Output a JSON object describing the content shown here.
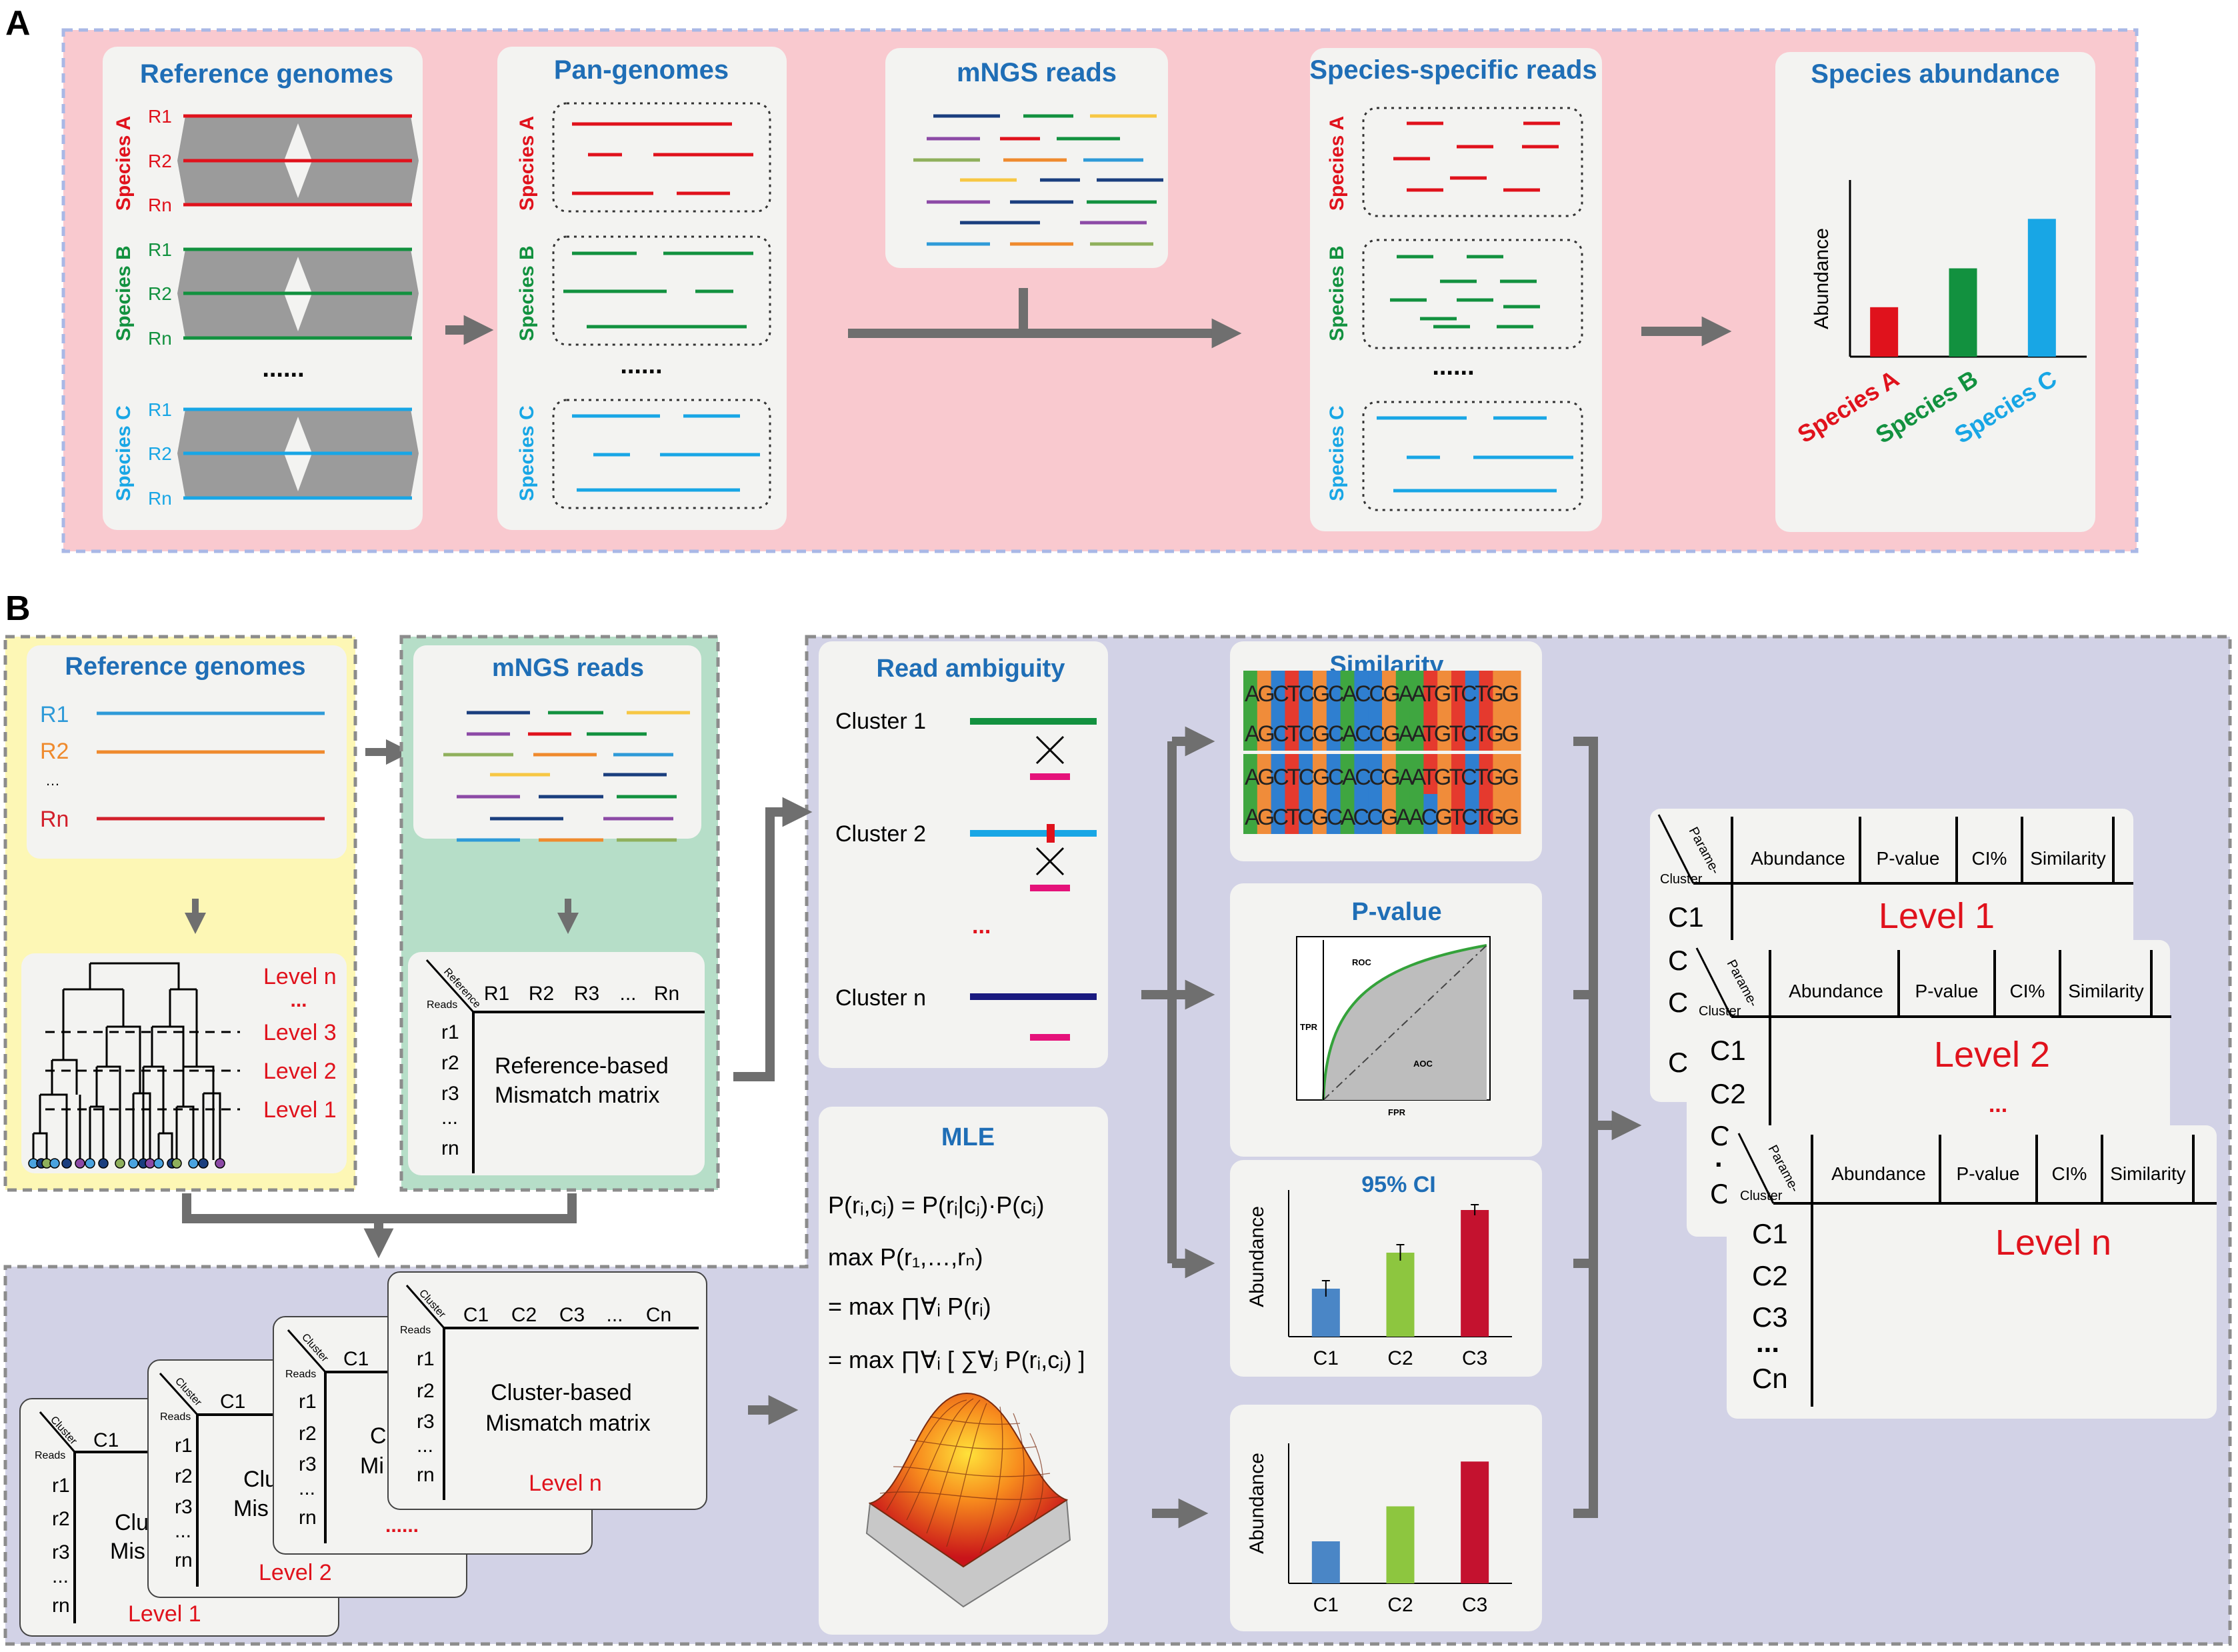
{
  "panel_labels": {
    "a": "A",
    "b": "B"
  },
  "colors": {
    "species_a": "#e0121c",
    "species_b": "#12913f",
    "species_c": "#18a6e5",
    "title_blue": "#1f6eb6",
    "level_red": "#e0121c",
    "panel_a_bg": "#f9c9cf",
    "panel_b_bg": "#d2d2e6",
    "yellow_bg": "#fdf7b5",
    "green_bg": "#b6dec8",
    "arrow": "#6f6f6f"
  },
  "panel_a": {
    "reference_genomes": {
      "title": "Reference genomes",
      "species": [
        {
          "name": "Species A",
          "reads": [
            "R1",
            "R2",
            "Rn"
          ]
        },
        {
          "name": "Species B",
          "reads": [
            "R1",
            "R2",
            "Rn"
          ]
        },
        {
          "name": "Species C",
          "reads": [
            "R1",
            "R2",
            "Rn"
          ]
        }
      ],
      "ellipsis": "......"
    },
    "pan_genomes": {
      "title": "Pan-genomes",
      "species": [
        "Species A",
        "Species B",
        "Species C"
      ],
      "ellipsis": "......"
    },
    "mngs_reads": {
      "title": "mNGS reads"
    },
    "species_specific": {
      "title": "Species-specific reads",
      "species": [
        "Species A",
        "Species B",
        "Species C"
      ],
      "ellipsis": "......"
    },
    "species_abundance": {
      "title": "Species abundance",
      "ylabel": "Abundance",
      "chart_data": {
        "type": "bar",
        "categories": [
          "Species A",
          "Species B",
          "Species C"
        ],
        "values": [
          0.28,
          0.5,
          0.78
        ],
        "colors": [
          "#e0121c",
          "#12913f",
          "#18a6e5"
        ],
        "ylim": [
          0,
          1
        ]
      }
    }
  },
  "panel_b": {
    "reference_genomes": {
      "title": "Reference genomes",
      "rows": [
        {
          "label": "R1",
          "color": "#2e9ad8"
        },
        {
          "label": "R2",
          "color": "#ef8a2d"
        },
        {
          "label": "Rn",
          "color": "#d21f2b"
        }
      ],
      "ellipsis": "…",
      "levels": [
        "Level n",
        "...",
        "Level 3",
        "Level 2",
        "Level 1"
      ]
    },
    "mngs_reads": {
      "title": "mNGS reads",
      "matrix": {
        "corner_top": "Reference",
        "corner_bottom": "Reads",
        "columns": [
          "R1",
          "R2",
          "R3",
          "...",
          "Rn"
        ],
        "rows": [
          "r1",
          "r2",
          "r3",
          "...",
          "rn"
        ],
        "caption_line1": "Reference-based",
        "caption_line2": "Mismatch matrix"
      }
    },
    "cluster_matrices": {
      "corner_top": "Cluster",
      "corner_bottom": "Reads",
      "columns": [
        "C1",
        "C2",
        "C3",
        "...",
        "Cn"
      ],
      "rows": [
        "r1",
        "r2",
        "r3",
        "...",
        "rn"
      ],
      "caption_line1": "Cluster-based",
      "caption_line2": "Mismatch matrix",
      "partial_col": "C1",
      "back_caption_line1": "Clu",
      "back_caption_line2": "Mis",
      "mid_caption_line1": "Cl",
      "mid_caption_line2": "Mi",
      "back_level": "Level 1",
      "mid_level": "Level 2",
      "front_level": "Level n",
      "dots": "......"
    },
    "read_ambiguity": {
      "title": "Read ambiguity",
      "clusters": [
        "Cluster 1",
        "Cluster 2",
        "Cluster n"
      ],
      "dots": "..."
    },
    "mle": {
      "title": "MLE",
      "eq1_lhs": "P(r",
      "eq_lines": [
        "P(rᵢ,cⱼ) = P(rᵢ|cⱼ)·P(cⱼ)",
        "max P(r₁,…,rₙ)",
        "= max ∏∀ᵢ P(rᵢ)",
        "= max ∏∀ᵢ [ ∑∀ⱼ P(rᵢ,cⱼ) ]"
      ]
    },
    "similarity": {
      "title": "Similarity",
      "sequences": [
        "AGCTCGCACCGAATGTCTGG",
        "AGCTCGCACCGAATGTCTGG",
        "AGCTCGCACCGAATGTCTGG",
        "AGCTCGCACCGAACGTCTGG"
      ]
    },
    "pvalue": {
      "title": "P-value",
      "roc": "ROC",
      "aoc": "AOC",
      "tpr": "TPR",
      "fpr": "FPR"
    },
    "ci": {
      "title": "95% CI",
      "ylabel": "Abundance",
      "chart_data": {
        "type": "bar",
        "categories": [
          "C1",
          "C2",
          "C3"
        ],
        "values": [
          0.36,
          0.63,
          0.95
        ],
        "errors": [
          0.06,
          0.06,
          0.04
        ],
        "colors": [
          "#4a86c6",
          "#8dc63f",
          "#c4122f"
        ],
        "ylim": [
          0,
          1.1
        ]
      }
    },
    "mle_bars": {
      "ylabel": "Abundance",
      "chart_data": {
        "type": "bar",
        "categories": [
          "C1",
          "C2",
          "C3"
        ],
        "values": [
          0.3,
          0.55,
          0.87
        ],
        "colors": [
          "#4a86c6",
          "#8dc63f",
          "#c4122f"
        ],
        "ylim": [
          0,
          1
        ]
      }
    },
    "result_tables": {
      "corner_top": "Parame-",
      "corner_bottom": "Cluster",
      "columns": [
        "Abundance",
        "P-value",
        "CI%",
        "Similarity"
      ],
      "rows": [
        "C1",
        "C2",
        "C3",
        "...",
        "Cn"
      ],
      "levels": [
        "Level 1",
        "Level 2",
        "Level n"
      ],
      "dots": "...",
      "back_rows_1": [
        "C1",
        "C",
        "C",
        "",
        "C"
      ],
      "back_rows_2": [
        "C1",
        "C2",
        "C",
        ".",
        "C"
      ]
    }
  }
}
